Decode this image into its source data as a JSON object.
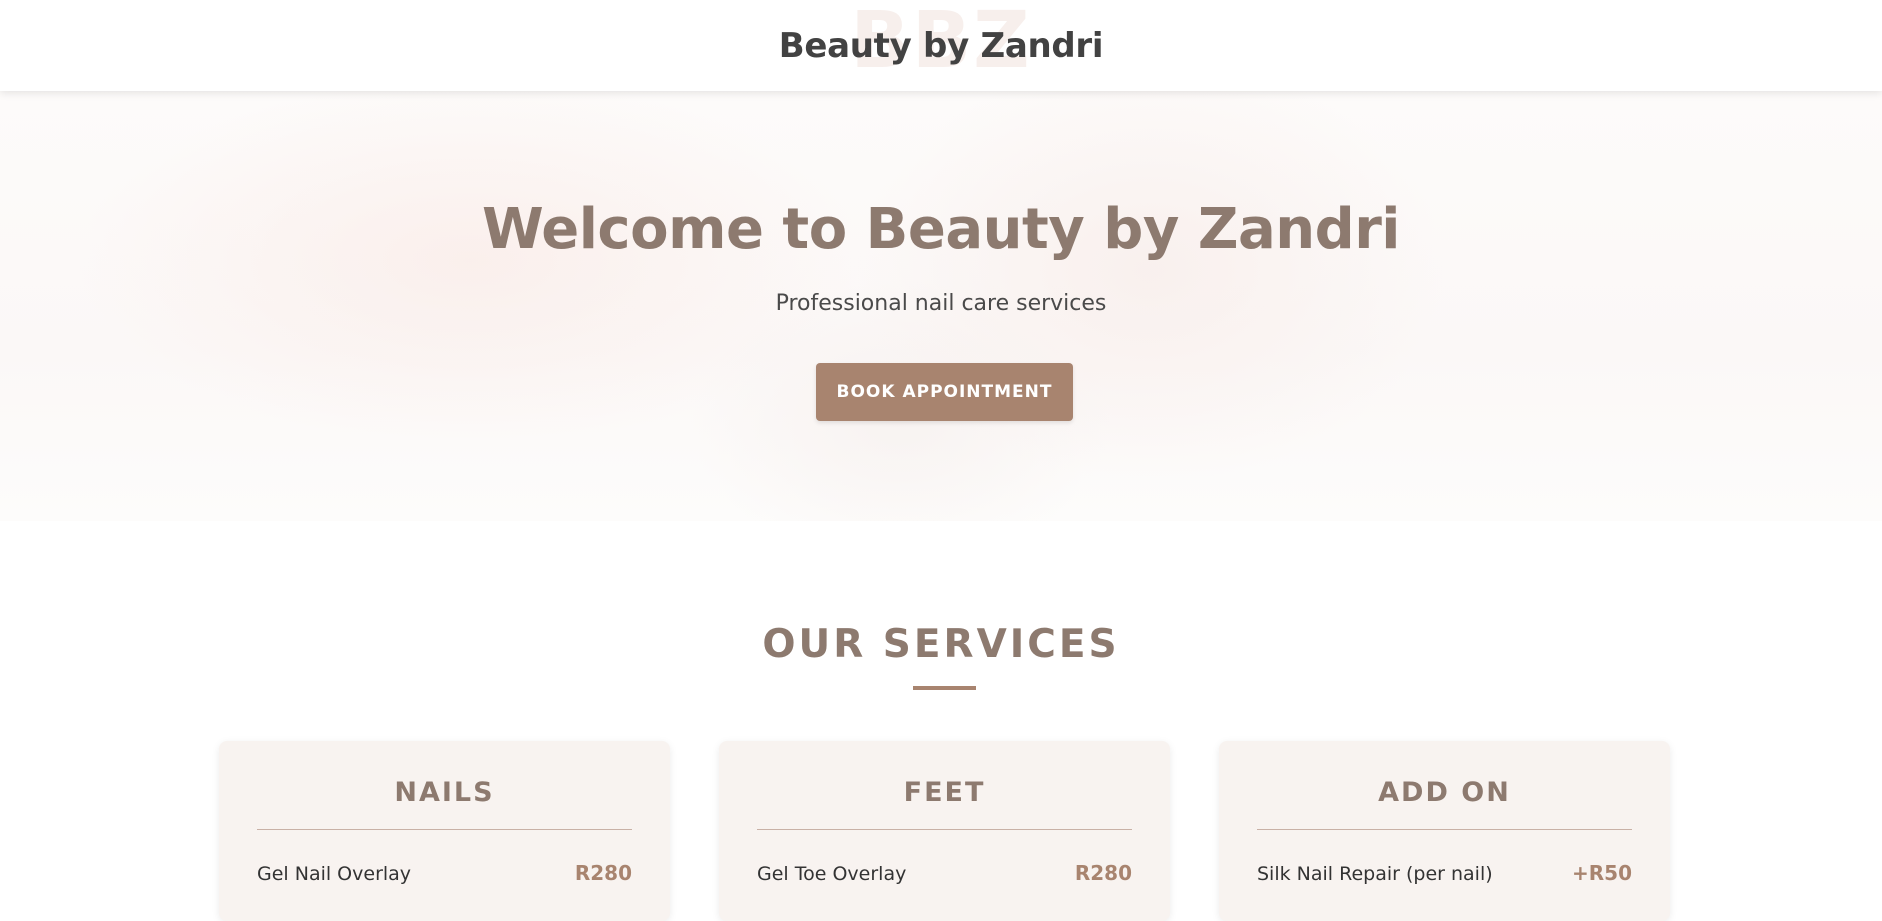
{
  "header": {
    "watermark": "BBZ",
    "title": "Beauty by Zandri"
  },
  "hero": {
    "title": "Welcome to Beauty by Zandri",
    "subtitle": "Professional nail care services",
    "cta_label": "BOOK APPOINTMENT"
  },
  "services": {
    "title": "OUR SERVICES",
    "categories": [
      {
        "heading": "NAILS",
        "items": [
          {
            "name": "Gel Nail Overlay",
            "price": "R280"
          }
        ]
      },
      {
        "heading": "FEET",
        "items": [
          {
            "name": "Gel Toe Overlay",
            "price": "R280"
          }
        ]
      },
      {
        "heading": "ADD ON",
        "items": [
          {
            "name": "Silk Nail Repair (per nail)",
            "price": "+R50"
          }
        ]
      }
    ]
  },
  "colors": {
    "accent": "#a8846f",
    "heading": "#8d7a6f",
    "card_background": "#f8f3f0"
  }
}
